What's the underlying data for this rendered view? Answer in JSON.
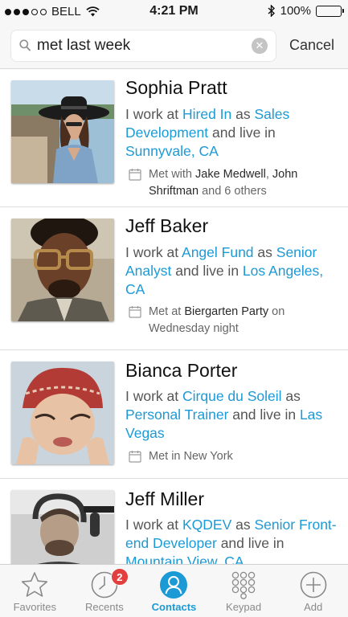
{
  "status_bar": {
    "carrier": "BELL",
    "time": "4:21 PM",
    "battery": "100%",
    "battery_level": 1.0
  },
  "search": {
    "query": "met last week",
    "cancel_label": "Cancel"
  },
  "contacts": [
    {
      "name": "Sophia Pratt",
      "bio": [
        {
          "t": "I work at ",
          "link": false
        },
        {
          "t": "Hired In",
          "link": true
        },
        {
          "t": " as ",
          "link": false
        },
        {
          "t": "Sales Development",
          "link": true
        },
        {
          "t": " and live in ",
          "link": false
        },
        {
          "t": "Sunnyvale, CA",
          "link": true
        }
      ],
      "met": [
        {
          "t": "Met with ",
          "strong": false
        },
        {
          "t": "Jake Medwell",
          "strong": true
        },
        {
          "t": ", ",
          "strong": false
        },
        {
          "t": "John Shriftman",
          "strong": true
        },
        {
          "t": " and 6 others",
          "strong": false
        }
      ]
    },
    {
      "name": "Jeff Baker",
      "bio": [
        {
          "t": "I work at ",
          "link": false
        },
        {
          "t": "Angel Fund",
          "link": true
        },
        {
          "t": " as ",
          "link": false
        },
        {
          "t": "Senior Analyst",
          "link": true
        },
        {
          "t": " and live in ",
          "link": false
        },
        {
          "t": "Los Angeles, CA",
          "link": true
        }
      ],
      "met": [
        {
          "t": "Met at ",
          "strong": false
        },
        {
          "t": "Biergarten Party",
          "strong": true
        },
        {
          "t": " on Wednesday night",
          "strong": false
        }
      ]
    },
    {
      "name": "Bianca Porter",
      "bio": [
        {
          "t": "I work at ",
          "link": false
        },
        {
          "t": "Cirque du Soleil",
          "link": true
        },
        {
          "t": " as ",
          "link": false
        },
        {
          "t": "Personal Trainer",
          "link": true
        },
        {
          "t": " and live in ",
          "link": false
        },
        {
          "t": "Las Vegas",
          "link": true
        }
      ],
      "met": [
        {
          "t": "Met in New York",
          "strong": false
        }
      ]
    },
    {
      "name": "Jeff Miller",
      "bio": [
        {
          "t": "I work at ",
          "link": false
        },
        {
          "t": "KQDEV",
          "link": true
        },
        {
          "t": " as ",
          "link": false
        },
        {
          "t": "Senior Front-end Developer",
          "link": true
        },
        {
          "t": " and live in ",
          "link": false
        },
        {
          "t": "Mountain View, CA",
          "link": true
        }
      ],
      "met": []
    }
  ],
  "tabs": [
    {
      "label": "Favorites",
      "icon": "star-icon",
      "active": false
    },
    {
      "label": "Recents",
      "icon": "clock-icon",
      "active": false,
      "badge": "2"
    },
    {
      "label": "Contacts",
      "icon": "person-icon",
      "active": true
    },
    {
      "label": "Keypad",
      "icon": "keypad-icon",
      "active": false
    },
    {
      "label": "Add",
      "icon": "plus-circle-icon",
      "active": false
    }
  ],
  "colors": {
    "accent": "#1b9ad6",
    "badge": "#e2403f",
    "text_muted": "#555555"
  }
}
